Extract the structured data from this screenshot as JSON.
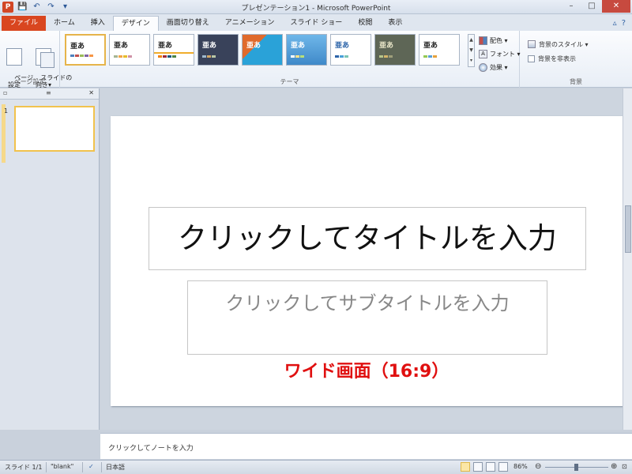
{
  "window": {
    "title": "プレゼンテーション1 - Microsoft PowerPoint",
    "app_icon": "P",
    "controls": [
      "–",
      "□",
      "✕"
    ]
  },
  "qat": {
    "save": "💾",
    "undo": "↶",
    "redo": "↷",
    "more": "▾"
  },
  "ribbon": {
    "tabs": [
      {
        "label": "ファイル"
      },
      {
        "label": "ホーム"
      },
      {
        "label": "挿入"
      },
      {
        "label": "デザイン"
      },
      {
        "label": "画面切り替え"
      },
      {
        "label": "アニメーション"
      },
      {
        "label": "スライド ショー"
      },
      {
        "label": "校閲"
      },
      {
        "label": "表示"
      }
    ],
    "right_icons": [
      "▵",
      "?"
    ],
    "page_setup": {
      "page_setup_label": "ページ\n設定",
      "orientation_label": "スライドの\n向き▾",
      "group_label": "ページ設定"
    },
    "themes": {
      "group_label": "テーマ",
      "items": [
        {
          "sample": "亜あ"
        },
        {
          "sample": "亜あ"
        },
        {
          "sample": "亜あ"
        },
        {
          "sample": "亜あ"
        },
        {
          "sample": "亜あ"
        },
        {
          "sample": "亜あ"
        },
        {
          "sample": "亜あ"
        },
        {
          "sample": "亜あ"
        },
        {
          "sample": "亜あ"
        }
      ],
      "colors_label": "配色 ▾",
      "fonts_label": "フォント ▾",
      "effects_label": "効果 ▾"
    },
    "background": {
      "group_label": "背景",
      "styles_label": "背景のスタイル ▾",
      "hide_graphics_label": "背景を非表示"
    }
  },
  "thumbnails": {
    "tab_slides_icon": "▫",
    "tab_outline_icon": "≡",
    "close": "✕",
    "slide_number": "1"
  },
  "slide": {
    "title_placeholder": "クリックしてタイトルを入力",
    "subtitle_placeholder": "クリックしてサブタイトルを入力",
    "annotation": "ワイド画面（16:9）"
  },
  "notes": {
    "placeholder": "クリックしてノートを入力"
  },
  "status": {
    "slide_info": "スライド 1/1",
    "theme_name": "\"blank\"",
    "language": "日本語",
    "zoom": "86%",
    "zoom_out": "⊖",
    "zoom_in": "⊕"
  }
}
